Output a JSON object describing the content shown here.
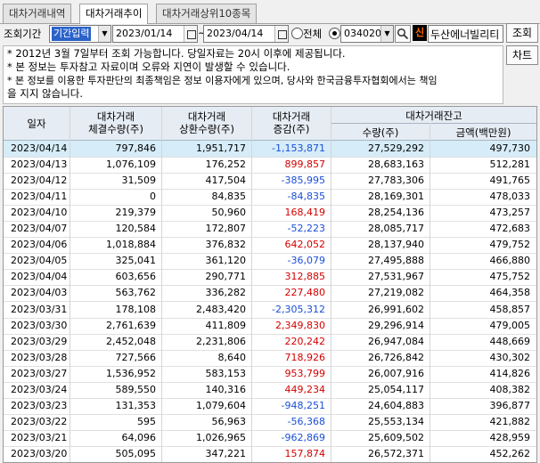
{
  "tabs": [
    "대차거래내역",
    "대차거래추이",
    "대차거래상위10종목"
  ],
  "active_tab": 1,
  "controls": {
    "period_label": "조회기간",
    "period_mode": "기간입력",
    "date_from": "2023/01/14",
    "date_sep": "~",
    "date_to": "2023/04/14",
    "radio_all_label": "전체",
    "stock_code": "034020",
    "stock_name_badge": "신",
    "stock_name": "두산에너빌리티",
    "search_button": "조회",
    "chart_button": "차트"
  },
  "notes": [
    "* 2012년 3월 7일부터 조회 가능합니다. 당일자료는 20시 이후에 제공됩니다.",
    "* 본 정보는 투자참고 자료이며 오류와 지연이 발생할 수 있습니다.",
    "* 본 정보를 이용한 투자판단의 최종책임은 정보 이용자에게 있으며, 당사와 한국금융투자협회에서는 책임",
    "  을 지지 않습니다."
  ],
  "table": {
    "headers": {
      "date": "일자",
      "executed_1": "대차거래",
      "executed_2": "체결수량(주)",
      "repaid_1": "대차거래",
      "repaid_2": "상환수량(주)",
      "change_1": "대차거래",
      "change_2": "증감(주)",
      "balance_group": "대차거래잔고",
      "balance_qty": "수량(주)",
      "balance_amt": "금액(백만원)"
    },
    "rows": [
      [
        "2023/04/14",
        "797,846",
        "1,951,717",
        "-1,153,871",
        "27,529,292",
        "497,730"
      ],
      [
        "2023/04/13",
        "1,076,109",
        "176,252",
        "899,857",
        "28,683,163",
        "512,281"
      ],
      [
        "2023/04/12",
        "31,509",
        "417,504",
        "-385,995",
        "27,783,306",
        "491,765"
      ],
      [
        "2023/04/11",
        "0",
        "84,835",
        "-84,835",
        "28,169,301",
        "478,033"
      ],
      [
        "2023/04/10",
        "219,379",
        "50,960",
        "168,419",
        "28,254,136",
        "473,257"
      ],
      [
        "2023/04/07",
        "120,584",
        "172,807",
        "-52,223",
        "28,085,717",
        "472,683"
      ],
      [
        "2023/04/06",
        "1,018,884",
        "376,832",
        "642,052",
        "28,137,940",
        "479,752"
      ],
      [
        "2023/04/05",
        "325,041",
        "361,120",
        "-36,079",
        "27,495,888",
        "466,880"
      ],
      [
        "2023/04/04",
        "603,656",
        "290,771",
        "312,885",
        "27,531,967",
        "475,752"
      ],
      [
        "2023/04/03",
        "563,762",
        "336,282",
        "227,480",
        "27,219,082",
        "464,358"
      ],
      [
        "2023/03/31",
        "178,108",
        "2,483,420",
        "-2,305,312",
        "26,991,602",
        "458,857"
      ],
      [
        "2023/03/30",
        "2,761,639",
        "411,809",
        "2,349,830",
        "29,296,914",
        "479,005"
      ],
      [
        "2023/03/29",
        "2,452,048",
        "2,231,806",
        "220,242",
        "26,947,084",
        "448,669"
      ],
      [
        "2023/03/28",
        "727,566",
        "8,640",
        "718,926",
        "26,726,842",
        "430,302"
      ],
      [
        "2023/03/27",
        "1,536,952",
        "583,153",
        "953,799",
        "26,007,916",
        "414,826"
      ],
      [
        "2023/03/24",
        "589,550",
        "140,316",
        "449,234",
        "25,054,117",
        "408,382"
      ],
      [
        "2023/03/23",
        "131,353",
        "1,079,604",
        "-948,251",
        "24,604,883",
        "396,877"
      ],
      [
        "2023/03/22",
        "595",
        "56,963",
        "-56,368",
        "25,553,134",
        "421,882"
      ],
      [
        "2023/03/21",
        "64,096",
        "1,026,965",
        "-962,869",
        "25,609,502",
        "428,959"
      ],
      [
        "2023/03/20",
        "505,095",
        "347,221",
        "157,874",
        "26,572,371",
        "452,262"
      ]
    ]
  }
}
